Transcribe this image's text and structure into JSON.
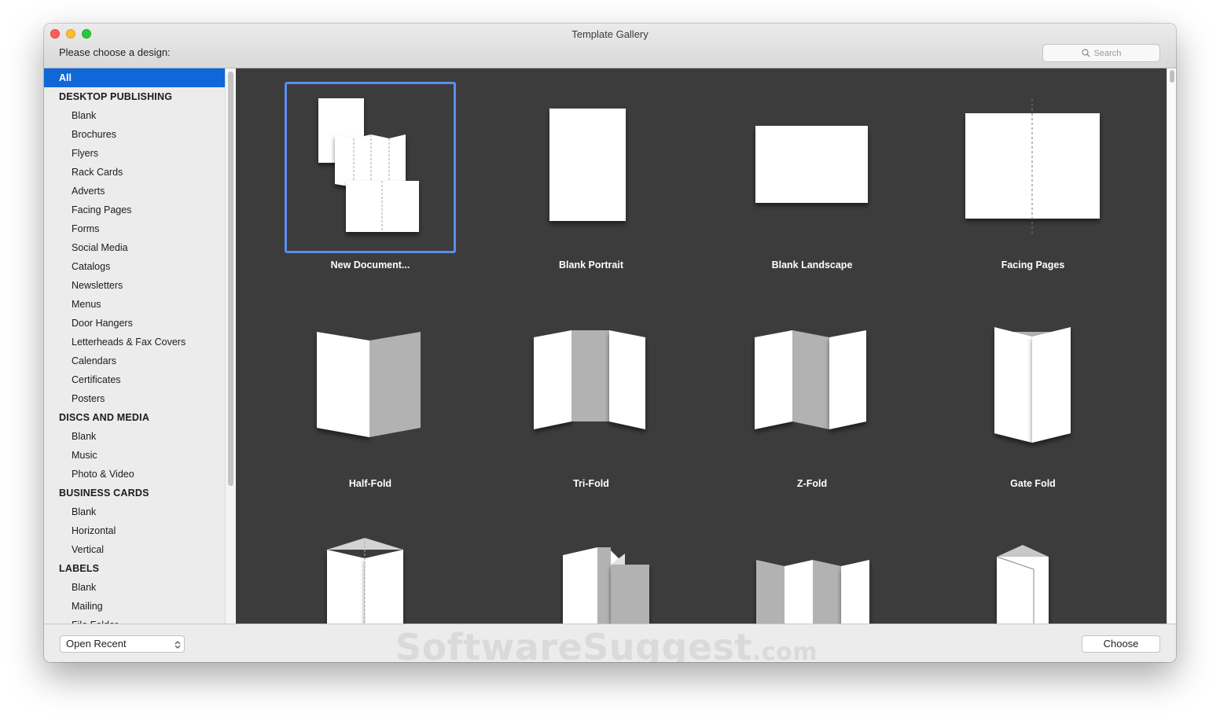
{
  "window": {
    "title": "Template Gallery",
    "prompt": "Please choose a design:"
  },
  "search": {
    "placeholder": "Search"
  },
  "sidebar": {
    "items": [
      {
        "label": "All",
        "kind": "selected"
      },
      {
        "label": "DESKTOP PUBLISHING",
        "kind": "header"
      },
      {
        "label": "Blank",
        "kind": "item"
      },
      {
        "label": "Brochures",
        "kind": "item"
      },
      {
        "label": "Flyers",
        "kind": "item"
      },
      {
        "label": "Rack Cards",
        "kind": "item"
      },
      {
        "label": "Adverts",
        "kind": "item"
      },
      {
        "label": "Facing Pages",
        "kind": "item"
      },
      {
        "label": "Forms",
        "kind": "item"
      },
      {
        "label": "Social Media",
        "kind": "item"
      },
      {
        "label": "Catalogs",
        "kind": "item"
      },
      {
        "label": "Newsletters",
        "kind": "item"
      },
      {
        "label": "Menus",
        "kind": "item"
      },
      {
        "label": "Door Hangers",
        "kind": "item"
      },
      {
        "label": "Letterheads & Fax Covers",
        "kind": "item"
      },
      {
        "label": "Calendars",
        "kind": "item"
      },
      {
        "label": "Certificates",
        "kind": "item"
      },
      {
        "label": "Posters",
        "kind": "item"
      },
      {
        "label": "DISCS AND MEDIA",
        "kind": "header"
      },
      {
        "label": "Blank",
        "kind": "item"
      },
      {
        "label": "Music",
        "kind": "item"
      },
      {
        "label": "Photo & Video",
        "kind": "item"
      },
      {
        "label": "BUSINESS CARDS",
        "kind": "header"
      },
      {
        "label": "Blank",
        "kind": "item"
      },
      {
        "label": "Horizontal",
        "kind": "item"
      },
      {
        "label": "Vertical",
        "kind": "item"
      },
      {
        "label": "LABELS",
        "kind": "header"
      },
      {
        "label": "Blank",
        "kind": "item"
      },
      {
        "label": "Mailing",
        "kind": "item"
      },
      {
        "label": "File Folder",
        "kind": "partial"
      }
    ]
  },
  "templates": [
    {
      "label": "New Document...",
      "icon": "new-document-icon",
      "selected": true
    },
    {
      "label": "Blank Portrait",
      "icon": "blank-portrait-icon"
    },
    {
      "label": "Blank Landscape",
      "icon": "blank-landscape-icon"
    },
    {
      "label": "Facing Pages",
      "icon": "facing-pages-icon"
    },
    {
      "label": "Half-Fold",
      "icon": "half-fold-icon"
    },
    {
      "label": "Tri-Fold",
      "icon": "tri-fold-icon"
    },
    {
      "label": "Z-Fold",
      "icon": "z-fold-icon"
    },
    {
      "label": "Gate Fold",
      "icon": "gate-fold-icon"
    },
    {
      "label": "",
      "icon": "vertical-half-fold-icon"
    },
    {
      "label": "",
      "icon": "roll-fold-icon"
    },
    {
      "label": "",
      "icon": "accordion-fold-icon"
    },
    {
      "label": "",
      "icon": "tent-fold-icon"
    }
  ],
  "bottom": {
    "open_recent": "Open Recent",
    "choose": "Choose"
  },
  "watermark": {
    "main": "SoftwareSuggest",
    "suffix": ".com"
  },
  "colors": {
    "selection_blue": "#0f67d8",
    "thumbnail_border": "#5b8cf2",
    "gallery_bg": "#3c3c3c"
  }
}
